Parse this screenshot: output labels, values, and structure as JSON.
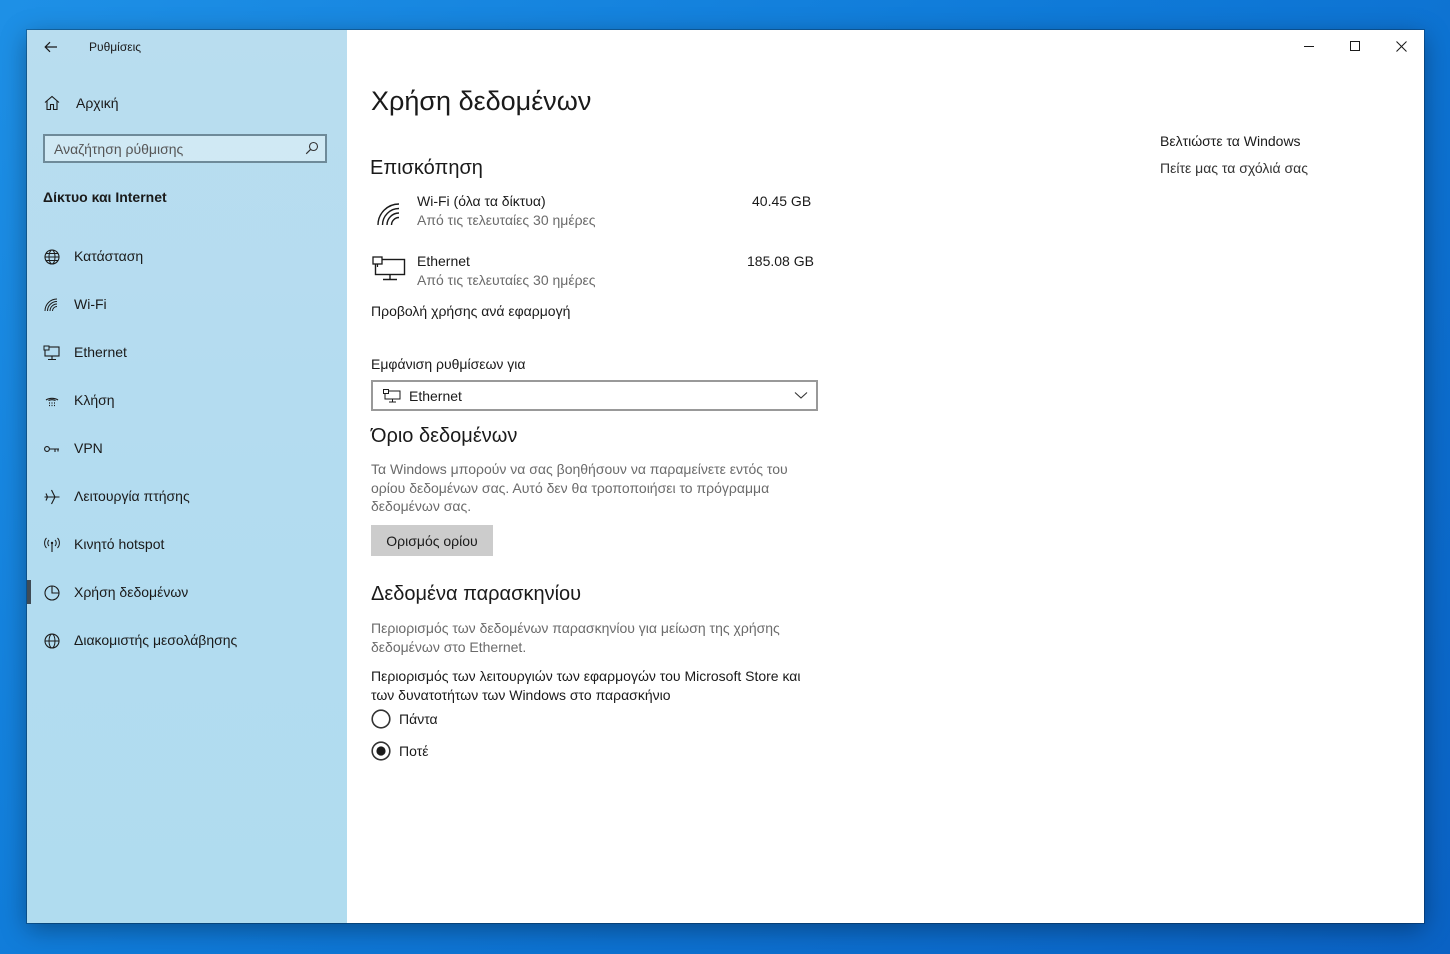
{
  "window": {
    "app_title": "Ρυθμίσεις"
  },
  "sidebar": {
    "home_label": "Αρχική",
    "search_placeholder": "Αναζήτηση ρύθμισης",
    "section_title": "Δίκτυο και Internet",
    "items": [
      {
        "label": "Κατάσταση",
        "icon": "globe-status-icon"
      },
      {
        "label": "Wi-Fi",
        "icon": "wifi-icon"
      },
      {
        "label": "Ethernet",
        "icon": "ethernet-icon"
      },
      {
        "label": "Κλήση",
        "icon": "dialup-icon"
      },
      {
        "label": "VPN",
        "icon": "vpn-icon"
      },
      {
        "label": "Λειτουργία πτήσης",
        "icon": "airplane-icon"
      },
      {
        "label": "Κινητό hotspot",
        "icon": "hotspot-icon"
      },
      {
        "label": "Χρήση δεδομένων",
        "icon": "pie-chart-icon",
        "active": true
      },
      {
        "label": "Διακομιστής μεσολάβησης",
        "icon": "globe-icon"
      }
    ]
  },
  "main": {
    "title": "Χρήση δεδομένων",
    "overview": {
      "heading": "Επισκόπηση",
      "wifi": {
        "name": "Wi-Fi (όλα τα δίκτυα)",
        "period": "Από τις τελευταίες 30 ημέρες",
        "amount": "40.45 GB"
      },
      "ethernet": {
        "name": "Ethernet",
        "period": "Από τις τελευταίες 30 ημέρες",
        "amount": "185.08 GB"
      },
      "per_app_link": "Προβολή χρήσης ανά εφαρμογή"
    },
    "show_settings": {
      "label": "Εμφάνιση ρυθμίσεων για",
      "selected": "Ethernet"
    },
    "data_limit": {
      "heading": "Όριο δεδομένων",
      "description": "Τα Windows μπορούν να σας βοηθήσουν να παραμείνετε εντός του ορίου δεδομένων σας. Αυτό δεν θα τροποποιήσει το πρόγραμμα δεδομένων σας.",
      "button": "Ορισμός ορίου"
    },
    "background_data": {
      "heading": "Δεδομένα παρασκηνίου",
      "description": "Περιορισμός των δεδομένων παρασκηνίου για μείωση της χρήσης δεδομένων στο Ethernet.",
      "question": "Περιορισμός των λειτουργιών των εφαρμογών του Microsoft Store και των δυνατοτήτων των Windows στο παρασκήνιο",
      "options": [
        {
          "label": "Πάντα",
          "selected": false
        },
        {
          "label": "Ποτέ",
          "selected": true
        }
      ]
    }
  },
  "right_panel": {
    "heading": "Βελτιώστε τα Windows",
    "link": "Πείτε μας τα σχόλιά σας"
  }
}
